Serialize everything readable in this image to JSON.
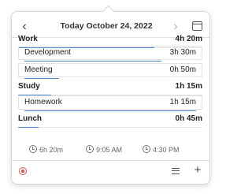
{
  "header": {
    "prev_icon": "chevron-left-icon",
    "prev_glyph": "‹",
    "title": "Today October 24, 2022",
    "next_icon": "chevron-right-icon",
    "next_glyph": "›",
    "calendar_icon": "calendar-icon"
  },
  "entries": [
    {
      "name": "Work",
      "duration": "4h 20m",
      "type": "group",
      "fraction": 0.74
    },
    {
      "name": "Development",
      "duration": "3h 30m",
      "type": "item",
      "fraction": 0.8
    },
    {
      "name": "Meeting",
      "duration": "0h 50m",
      "type": "item",
      "fraction": 0.2
    },
    {
      "name": "Study",
      "duration": "1h 15m",
      "type": "group",
      "fraction": 0.18
    },
    {
      "name": "Homework",
      "duration": "1h 15m",
      "type": "item",
      "fraction": 1.0
    },
    {
      "name": "Lunch",
      "duration": "0h 45m",
      "type": "group",
      "fraction": 0.11
    }
  ],
  "stats": {
    "total": "6h 20m",
    "start": "9:05 AM",
    "end": "4:30 PM"
  },
  "footer": {
    "record_icon": "record-icon",
    "menu_icon": "menu-icon",
    "add_icon": "plus-icon",
    "add_glyph": "+"
  },
  "colors": {
    "accent": "#4b86c8",
    "record": "#d9534f"
  }
}
